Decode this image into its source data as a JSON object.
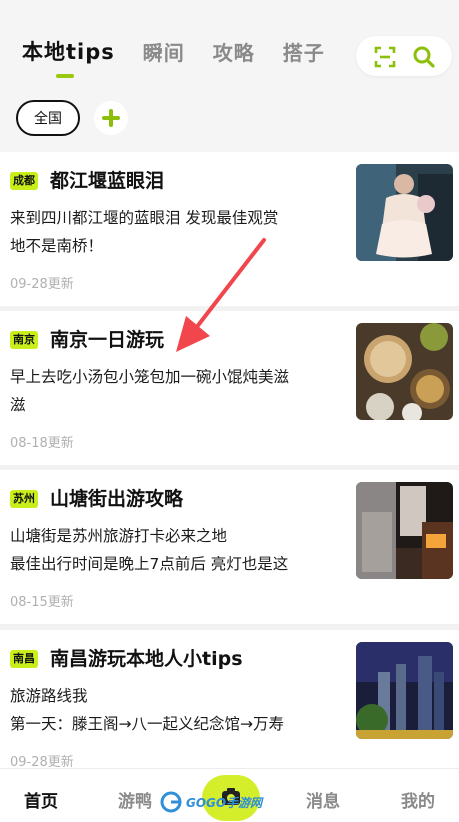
{
  "colors": {
    "accent": "#c8ef1a",
    "accent_dark": "#8cbf0a",
    "arrow": "#f0464c"
  },
  "header": {
    "tabs": [
      {
        "label": "本地tips",
        "active": true
      },
      {
        "label": "瞬间"
      },
      {
        "label": "攻略"
      },
      {
        "label": "搭子"
      }
    ],
    "scan_icon": "scan-icon",
    "search_icon": "search-icon"
  },
  "region": {
    "selected": "全国",
    "add_icon": "plus-icon"
  },
  "cards": [
    {
      "tag": "成都",
      "title": "都江堰蓝眼泪",
      "desc_lines": [
        "来到四川都江堰的蓝眼泪 发现最佳观赏",
        "地不是南桥！"
      ],
      "date": "09-28更新"
    },
    {
      "tag": "南京",
      "title": "南京一日游玩",
      "desc_lines": [
        "早上去吃小汤包小笼包加一碗小馄炖美滋",
        "滋"
      ],
      "date": "08-18更新"
    },
    {
      "tag": "苏州",
      "title": "山塘街出游攻略",
      "desc_lines": [
        "山塘街是苏州旅游打卡必来之地",
        "最佳出行时间是晚上7点前后 亮灯也是这"
      ],
      "date": "08-15更新"
    },
    {
      "tag": "南昌",
      "title": "南昌游玩本地人小tips",
      "desc_lines": [
        "旅游路线我",
        "第一天：滕王阁→八一起义纪念馆→万寿"
      ],
      "date": "09-28更新"
    }
  ],
  "bottom_nav": [
    {
      "label": "首页",
      "active": true
    },
    {
      "label": "游鸭"
    },
    {
      "label": "消息"
    },
    {
      "label": "我的"
    }
  ],
  "watermark": {
    "text": "GOGO手游网"
  }
}
